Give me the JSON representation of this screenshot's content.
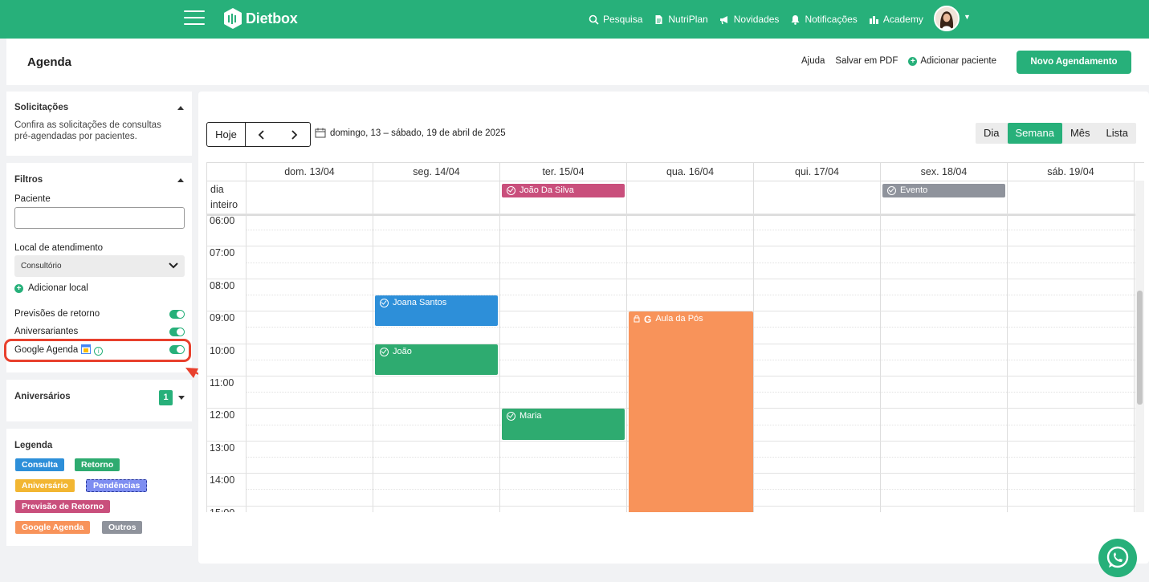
{
  "topbar": {
    "brand": "Dietbox",
    "nav": [
      {
        "label": "Pesquisa",
        "icon": "search-icon"
      },
      {
        "label": "NutriPlan",
        "icon": "document-icon"
      },
      {
        "label": "Novidades",
        "icon": "megaphone-icon"
      },
      {
        "label": "Notificações",
        "icon": "bell-icon"
      },
      {
        "label": "Academy",
        "icon": "academy-icon"
      }
    ]
  },
  "header": {
    "title": "Agenda",
    "help": "Ajuda",
    "save_pdf": "Salvar em PDF",
    "add_patient": "Adicionar paciente",
    "new_appointment": "Novo Agendamento"
  },
  "sidebar": {
    "requests": {
      "title": "Solicitações",
      "description": "Confira as solicitações de consultas pré-agendadas por pacientes."
    },
    "filters": {
      "title": "Filtros",
      "patient_label": "Paciente",
      "patient_value": "",
      "location_label": "Local de atendimento",
      "location_value": "Consultório",
      "add_location": "Adicionar local",
      "toggles": [
        {
          "label": "Previsões de retorno",
          "on": true
        },
        {
          "label": "Aniversariantes",
          "on": true
        },
        {
          "label": "Google Agenda",
          "on": true
        }
      ]
    },
    "birthdays": {
      "title": "Aniversários",
      "count": "1"
    },
    "legend": {
      "title": "Legenda",
      "items": [
        {
          "label": "Consulta",
          "color": "#2d8fd9"
        },
        {
          "label": "Retorno",
          "color": "#2eab70"
        },
        {
          "label": "Aniversário",
          "color": "#f2b632"
        },
        {
          "label": "Pendências",
          "color": "#7e8ef1"
        },
        {
          "label": "Previsão de Retorno",
          "color": "#c94f7c"
        },
        {
          "label": "Google Agenda",
          "color": "#f8935a"
        },
        {
          "label": "Outros",
          "color": "#8f939c"
        }
      ]
    }
  },
  "calendar": {
    "today": "Hoje",
    "range": "domingo, 13 – sábado, 19 de abril de 2025",
    "views": [
      "Dia",
      "Semana",
      "Mês",
      "Lista"
    ],
    "active_view": "Semana",
    "allday_label": "dia inteiro",
    "days": [
      "dom. 13/04",
      "seg. 14/04",
      "ter. 15/04",
      "qua. 16/04",
      "qui. 17/04",
      "sex. 18/04",
      "sáb. 19/04"
    ],
    "hours": [
      "06:00",
      "07:00",
      "08:00",
      "09:00",
      "10:00",
      "11:00",
      "12:00",
      "13:00",
      "14:00",
      "15:00"
    ],
    "allday_events": [
      {
        "title": "João Da Silva",
        "day": 2,
        "color": "#c94f7c"
      },
      {
        "title": "Evento",
        "day": 5,
        "color": "#8f939c"
      }
    ],
    "events": [
      {
        "title": "Joana Santos",
        "day": 1,
        "start": "08:30",
        "end": "09:30",
        "color": "#2d8fd9",
        "icon": "check-circle-icon"
      },
      {
        "title": "João",
        "day": 1,
        "start": "10:00",
        "end": "11:00",
        "color": "#2eab70",
        "icon": "check-circle-icon"
      },
      {
        "title": "Maria",
        "day": 2,
        "start": "12:00",
        "end": "13:00",
        "color": "#2eab70",
        "icon": "check-circle-icon"
      },
      {
        "title": "Aula da Pós",
        "day": 3,
        "start": "09:00",
        "end": "15:30",
        "color": "#f8935a",
        "icon": "google-icon"
      }
    ]
  },
  "colors": {
    "brand": "#27b07a",
    "highlight": "#e8402d"
  }
}
